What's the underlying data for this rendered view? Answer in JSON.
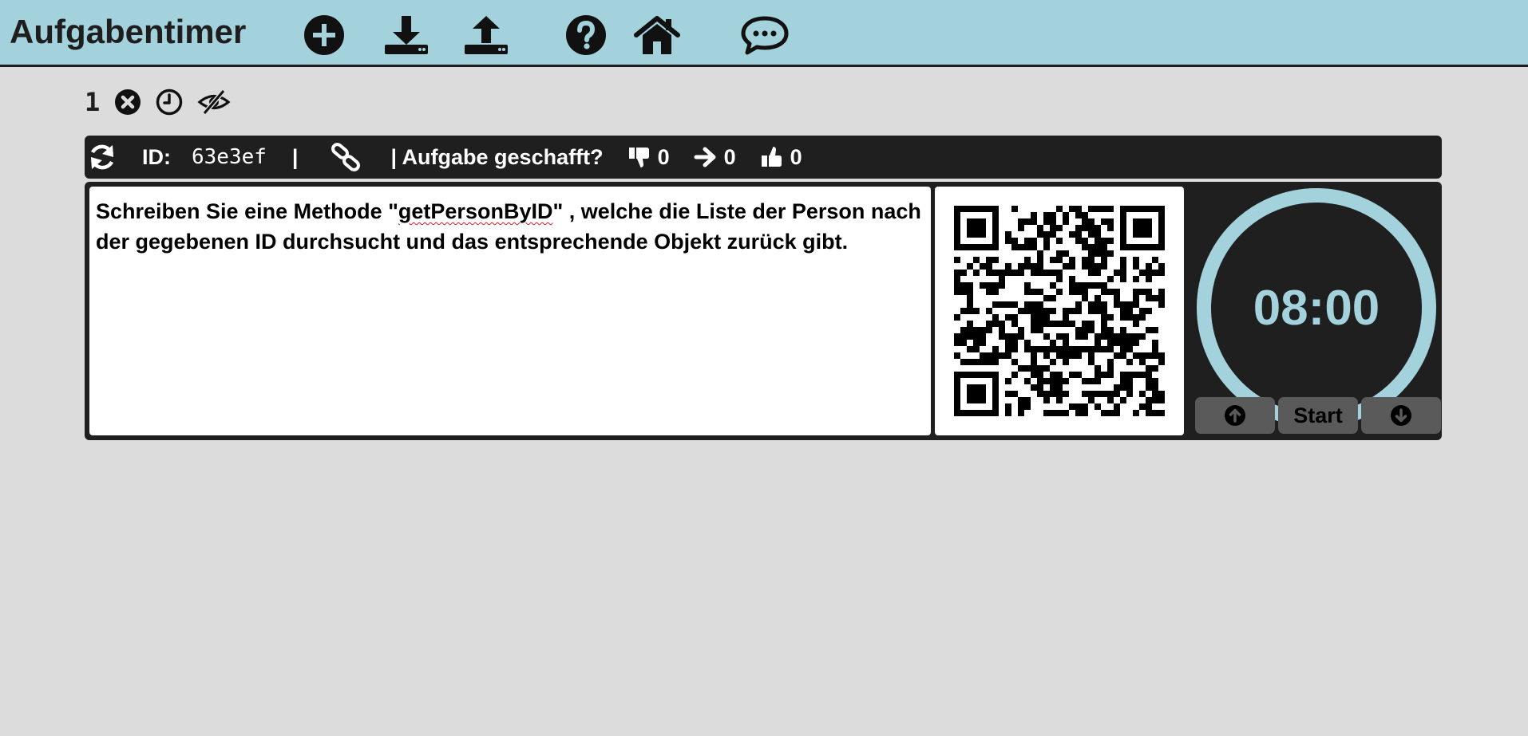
{
  "app": {
    "title": "Aufgabentimer"
  },
  "header": {
    "icons": [
      "add-icon",
      "download-icon",
      "upload-icon",
      "help-icon",
      "home-icon",
      "comment-icon"
    ]
  },
  "task": {
    "number": "1",
    "id_label": "ID:",
    "id_value": "63e3ef",
    "separator": "|",
    "done_question": "| Aufgabe geschafft?",
    "votes": {
      "down": "0",
      "neutral": "0",
      "up": "0"
    },
    "text_before": "Schreiben Sie eine Methode \"",
    "text_method": "getPersonByID",
    "text_after": "\" , welche die Liste der Person nach der gegebenen ID durchsucht und das entsprechende Objekt zurück gibt."
  },
  "timer": {
    "time": "08:00",
    "start_label": "Start"
  },
  "colors": {
    "accent": "#a3d2dc",
    "dark": "#1f1f1f",
    "background": "#dcdcdc",
    "button": "#5a5a5a"
  }
}
